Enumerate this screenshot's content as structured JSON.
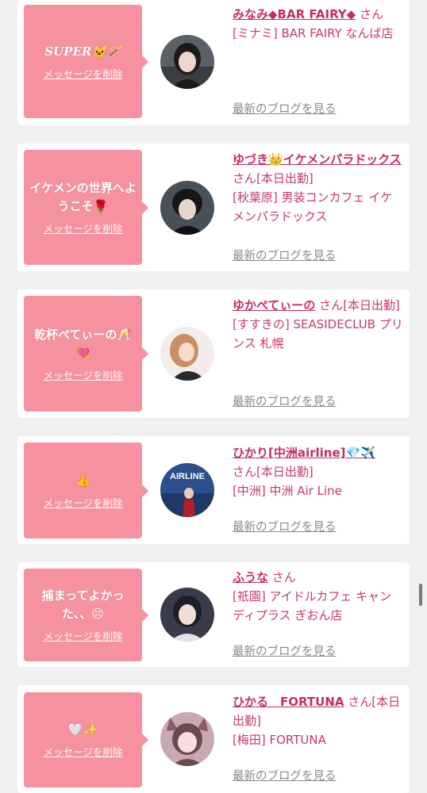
{
  "cards": [
    {
      "message": "SUPER🐱🪄",
      "delete_label": "メッセージを削除",
      "name": "みなみ◆BAR FAIRY◆",
      "san": "さん",
      "shop": "[ミナミ] BAR FAIRY なんば店",
      "blog_label": "最新のブログを見る"
    },
    {
      "message": "イケメンの世界へようこそ🌹",
      "delete_label": "メッセージを削除",
      "name": "ゆづき👑イケメンパラドックス",
      "san": "さん[本日出勤]",
      "shop": "[秋葉原] 男装コンカフェ イケメンパラドックス",
      "blog_label": "最新のブログを見る"
    },
    {
      "message": "乾杯ぺてぃーの🥂💘",
      "delete_label": "メッセージを削除",
      "name": "ゆかぺてぃーの",
      "san": "さん[本日出勤]",
      "shop": "[すすきの] SEASIDECLUB プリンス 札幌",
      "blog_label": "最新のブログを見る"
    },
    {
      "message": "👍",
      "delete_label": "メッセージを削除",
      "name": "ひかり[中洲airline]💎✈️",
      "san": "さん[本日出勤]",
      "shop": "[中洲] 中洲 Air Line",
      "blog_label": "最新のブログを見る",
      "avatar_text": "AIRLINE"
    },
    {
      "message": "捕まってよかった、、😣",
      "delete_label": "メッセージを削除",
      "name": "ふうな",
      "san": "さん",
      "shop": "[祇園] アイドルカフェ キャンディプラス ぎおん店",
      "blog_label": "最新のブログを見る"
    },
    {
      "message": "🤍✨",
      "delete_label": "メッセージを削除",
      "name": "ひかる　FORTUNA",
      "san": "さん[本日出勤]",
      "shop": "[梅田] FORTUNA",
      "blog_label": "最新のブログを見る"
    }
  ],
  "colors": {
    "bubble": "#f6929f",
    "name": "#c62e60",
    "text": "#c73a62",
    "muted": "#8a8a8a",
    "background": "#f0f0f0"
  }
}
